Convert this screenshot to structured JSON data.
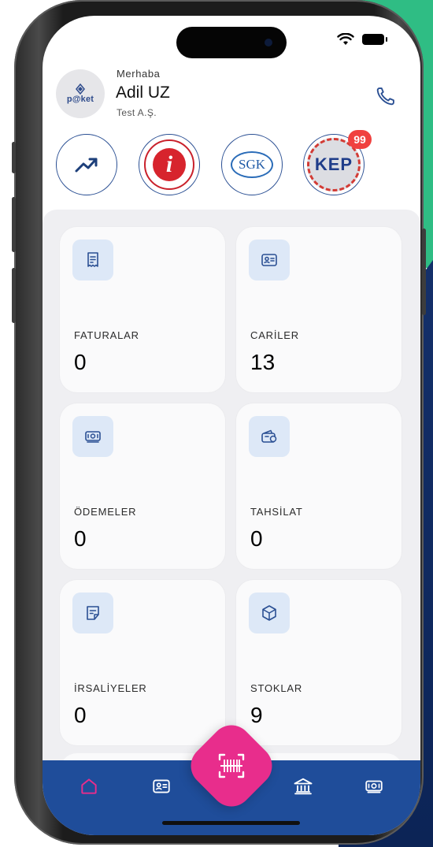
{
  "header": {
    "greeting": "Merhaba",
    "user_name": "Adil UZ",
    "company": "Test A.Ş.",
    "logo_text": "p@ket"
  },
  "shortcuts": [
    {
      "name": "reports",
      "icon": "trending-up-icon"
    },
    {
      "name": "gib",
      "icon": "gib-logo",
      "logo_text": "i"
    },
    {
      "name": "sgk",
      "icon": "sgk-logo",
      "logo_text": "SGK"
    },
    {
      "name": "kep",
      "icon": "kep-logo",
      "logo_text": "KEP",
      "badge": "99"
    }
  ],
  "cards": [
    {
      "label": "FATURALAR",
      "value": "0",
      "icon": "receipt-icon"
    },
    {
      "label": "CARİLER",
      "value": "13",
      "icon": "id-card-icon"
    },
    {
      "label": "ÖDEMELER",
      "value": "0",
      "icon": "banknote-icon"
    },
    {
      "label": "TAHSİLAT",
      "value": "0",
      "icon": "wallet-icon"
    },
    {
      "label": "İRSALİYELER",
      "value": "0",
      "icon": "note-icon"
    },
    {
      "label": "STOKLAR",
      "value": "9",
      "icon": "box-icon"
    }
  ],
  "nav": {
    "items": [
      "home-icon",
      "id-card-icon",
      "barcode-scan-icon",
      "bank-icon",
      "banknote-icon"
    ],
    "active": "home-icon"
  },
  "colors": {
    "accent": "#e82d8c",
    "primary": "#1f4d9a",
    "icon": "#2a4f93",
    "icon_bg": "#dde8f7",
    "badge": "#f0413f"
  }
}
